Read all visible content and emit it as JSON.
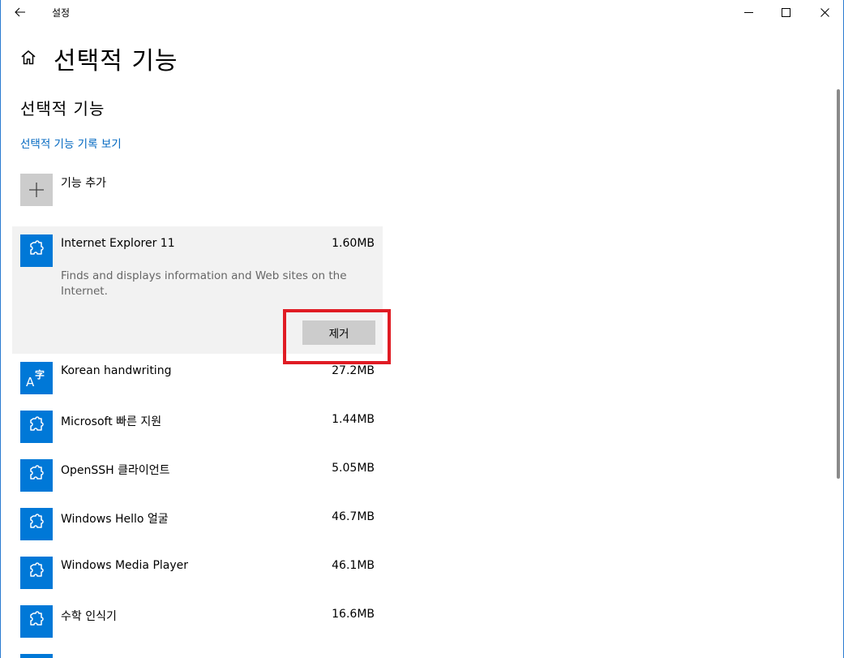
{
  "window": {
    "title": "설정"
  },
  "header": {
    "page_title": "선택적 기능"
  },
  "section": {
    "title": "선택적 기능",
    "history_link": "선택적 기능 기록 보기",
    "add_label": "기능 추가"
  },
  "features": [
    {
      "name": "Internet Explorer 11",
      "size": "1.60MB",
      "icon": "puzzle-icon",
      "expanded": true,
      "description": "Finds and displays information and Web sites on the Internet.",
      "remove_label": "제거"
    },
    {
      "name": "Korean handwriting",
      "size": "27.2MB",
      "icon": "language-icon"
    },
    {
      "name": "Microsoft 빠른 지원",
      "size": "1.44MB",
      "icon": "puzzle-icon"
    },
    {
      "name": "OpenSSH 클라이언트",
      "size": "5.05MB",
      "icon": "puzzle-icon"
    },
    {
      "name": "Windows Hello 얼굴",
      "size": "46.7MB",
      "icon": "puzzle-icon"
    },
    {
      "name": "Windows Media Player",
      "size": "46.1MB",
      "icon": "puzzle-icon"
    },
    {
      "name": "수학 인식기",
      "size": "16.6MB",
      "icon": "puzzle-icon"
    }
  ],
  "colors": {
    "accent": "#0078d7",
    "link": "#0067c0",
    "highlight": "#e01c24",
    "expanded_bg": "#f2f2f2"
  }
}
